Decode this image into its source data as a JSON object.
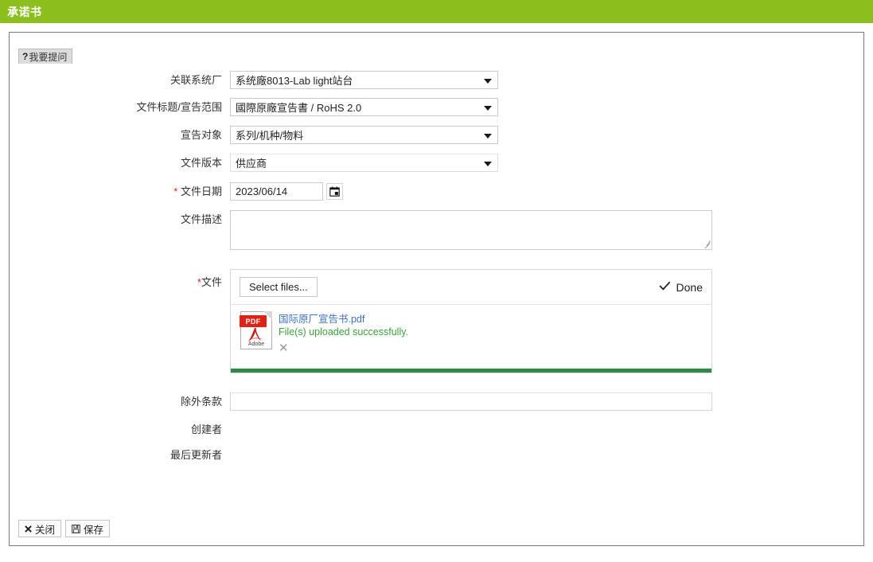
{
  "header": {
    "title": "承诺书",
    "bar_color": "#8cbe1e"
  },
  "tab": {
    "marker": "?",
    "label": "我要提问"
  },
  "form": {
    "rows": [
      {
        "label": "关联系统厂",
        "required": false,
        "type": "select",
        "value": "系统廠8013-Lab light站台"
      },
      {
        "label": "文件标题/宣告范围",
        "required": false,
        "type": "select",
        "value": "國際原廠宣告書 / RoHS 2.0"
      },
      {
        "label": "宣告对象",
        "required": false,
        "type": "select",
        "value": "系列/机种/物料"
      },
      {
        "label": "文件版本",
        "required": false,
        "type": "select",
        "value": "供应商"
      },
      {
        "label": "文件日期",
        "required": true,
        "type": "date",
        "value": "2023/06/14"
      },
      {
        "label": "文件描述",
        "required": false,
        "type": "textarea",
        "value": ""
      },
      {
        "label": "文件",
        "required": true,
        "type": "upload",
        "value": ""
      },
      {
        "label": "除外条款",
        "required": false,
        "type": "text",
        "value": ""
      },
      {
        "label": "创建者",
        "required": false,
        "type": "static",
        "value": ""
      },
      {
        "label": "最后更新者",
        "required": false,
        "type": "static",
        "value": ""
      }
    ]
  },
  "upload": {
    "select_button": "Select files...",
    "done_label": "Done",
    "done_check": "✔",
    "file_icon_type": "pdf",
    "pdf_badge": "PDF",
    "pdf_brand": "Adobe",
    "file_name": "国际原厂宣告书.pdf",
    "status_text": "File(s) uploaded successfully.",
    "remove_symbol": "✕",
    "progress_color": "#2e8b45",
    "progress_percent": 100,
    "link_color": "#3b73c4",
    "status_color": "#3aa23a"
  },
  "footer": {
    "close_icon": "✖",
    "close_label": "关闭",
    "save_icon": "💾",
    "save_label": "保存"
  }
}
